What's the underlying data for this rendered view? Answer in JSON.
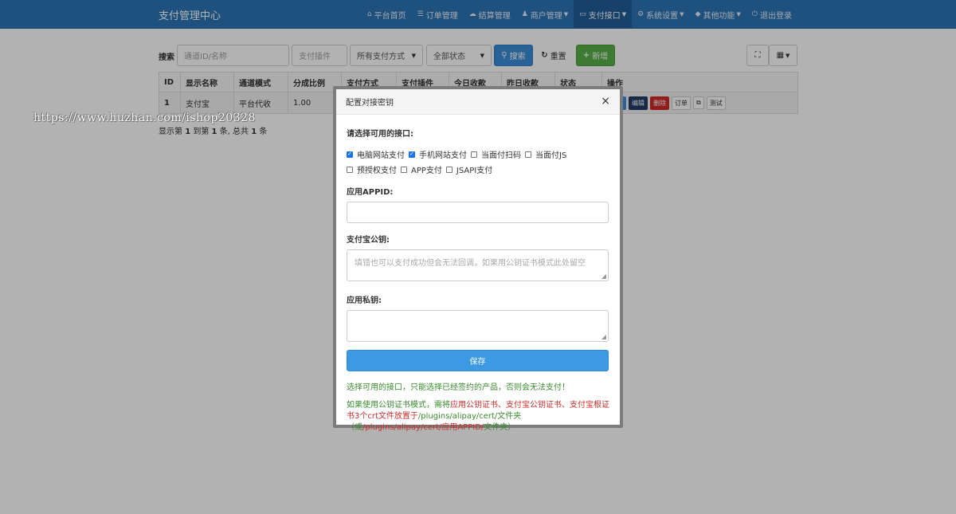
{
  "navbar": {
    "brand": "支付管理中心",
    "items": [
      {
        "icon": "home-icon",
        "glyph": "⌂",
        "label": "平台首页",
        "caret": false,
        "active": false
      },
      {
        "icon": "list-icon",
        "glyph": "☰",
        "label": "订单管理",
        "caret": false,
        "active": false
      },
      {
        "icon": "cloud-icon",
        "glyph": "☁",
        "label": "结算管理",
        "caret": false,
        "active": false
      },
      {
        "icon": "user-icon",
        "glyph": "♟",
        "label": "商户管理",
        "caret": true,
        "active": false
      },
      {
        "icon": "credit-card-icon",
        "glyph": "▭",
        "label": "支付接口",
        "caret": true,
        "active": true
      },
      {
        "icon": "gear-icon",
        "glyph": "⚙",
        "label": "系统设置",
        "caret": true,
        "active": false
      },
      {
        "icon": "cube-icon",
        "glyph": "◆",
        "label": "其他功能",
        "caret": true,
        "active": false
      },
      {
        "icon": "power-icon",
        "glyph": "⏻",
        "label": "退出登录",
        "caret": false,
        "active": false
      }
    ]
  },
  "toolbar": {
    "search_label": "搜索",
    "channel_placeholder": "通道ID/名称",
    "plugin_placeholder": "支付插件",
    "paytype_select": "所有支付方式",
    "status_select": "全部状态",
    "search_button": "搜索",
    "reset_button": "重置",
    "add_button": "新增"
  },
  "table": {
    "columns": [
      "ID",
      "显示名称",
      "通道模式",
      "分成比例",
      "支付方式",
      "支付插件",
      "今日收款",
      "昨日收款",
      "状态",
      "操作"
    ],
    "rows": [
      {
        "id": "1",
        "name": "支付宝",
        "mode": "平台代收",
        "ratio": "1.00"
      }
    ],
    "row_ops": {
      "key": "密钥",
      "edit": "编辑",
      "delete": "删除",
      "orders": "订单",
      "test": "测试"
    },
    "pagination": {
      "prefix": "显示第",
      "start": "1",
      "mid1": "到第",
      "end": "1",
      "mid2": "条, 总共",
      "total": "1",
      "suffix": "条"
    }
  },
  "watermark": "https://www.huzhan.com/ishop20328",
  "modal": {
    "title": "配置对接密钥",
    "close": "×",
    "interfaces_label": "请选择可用的接口:",
    "interfaces": [
      {
        "label": "电脑网站支付",
        "checked": true
      },
      {
        "label": "手机网站支付",
        "checked": true
      },
      {
        "label": "当面付扫码",
        "checked": false
      },
      {
        "label": "当面付JS",
        "checked": false
      },
      {
        "label": "预授权支付",
        "checked": false
      },
      {
        "label": "APP支付",
        "checked": false
      },
      {
        "label": "JSAPI支付",
        "checked": false
      }
    ],
    "appid_label": "应用APPID:",
    "appid_value": "",
    "pubkey_label": "支付宝公钥:",
    "pubkey_placeholder": "填错也可以支付成功但会无法回调，如果用公钥证书模式此处留空",
    "privkey_label": "应用私钥:",
    "privkey_value": "",
    "save_button": "保存",
    "note1": "选择可用的接口，只能选择已经签约的产品，否则会无法支付！",
    "note2": {
      "a": "如果使用公钥证书模式，需将",
      "b": "应用公钥证书、支付宝公钥证书、支付宝根证书3个crt文件放置于",
      "c": "/plugins/alipay/cert/",
      "d": "文件夹（或",
      "e": "/plugins/alipay/cert/应用APPID/",
      "f": "文件夹）"
    }
  }
}
